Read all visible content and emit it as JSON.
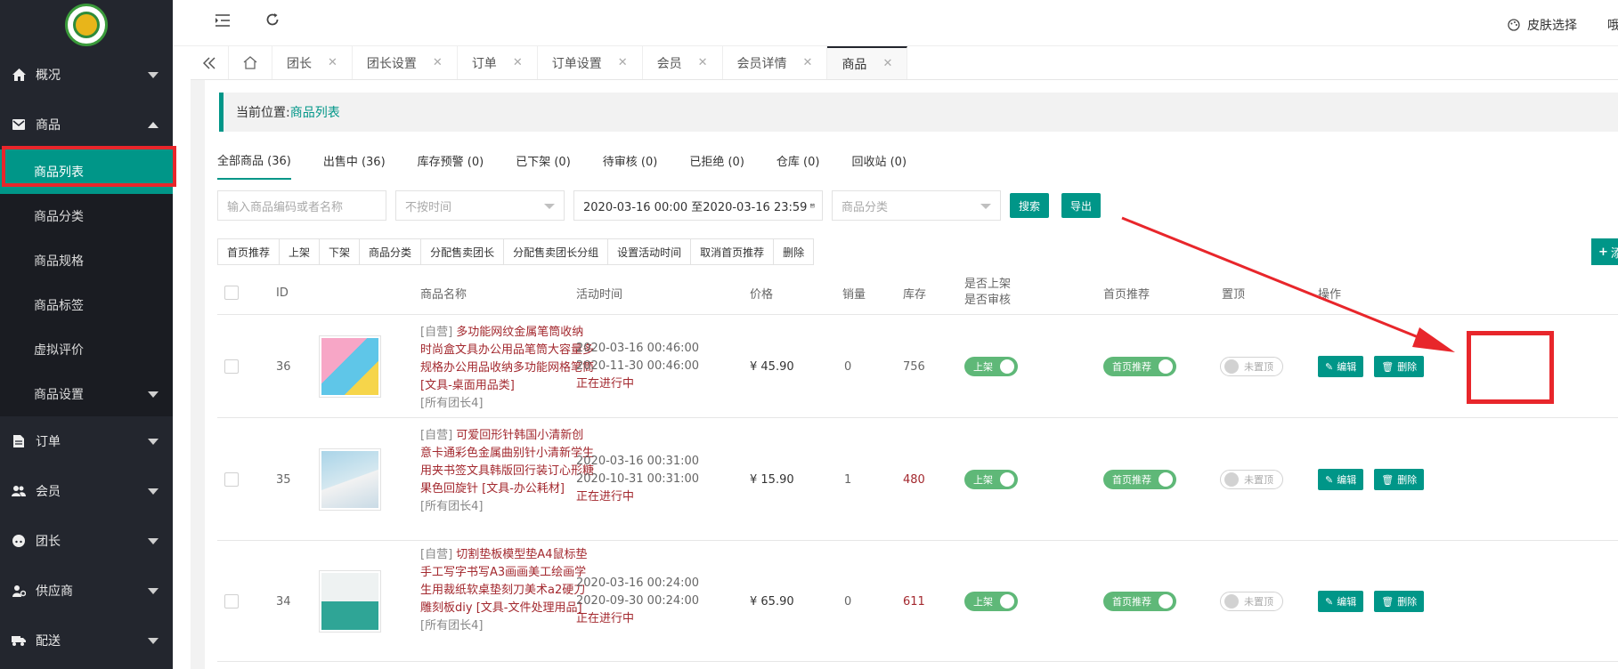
{
  "sidebar": {
    "items": [
      {
        "label": "概况",
        "icon": "home-icon",
        "expanded": false
      },
      {
        "label": "商品",
        "icon": "mail-icon",
        "expanded": true
      },
      {
        "label": "订单",
        "icon": "document-icon",
        "expanded": false
      },
      {
        "label": "会员",
        "icon": "users-icon",
        "expanded": false
      },
      {
        "label": "团长",
        "icon": "face-icon",
        "expanded": false
      },
      {
        "label": "供应商",
        "icon": "user-gear-icon",
        "expanded": false
      },
      {
        "label": "配送",
        "icon": "truck-icon",
        "expanded": false
      }
    ],
    "submenu": [
      {
        "label": "商品列表",
        "active": true
      },
      {
        "label": "商品分类"
      },
      {
        "label": "商品规格"
      },
      {
        "label": "商品标签"
      },
      {
        "label": "虚拟评价"
      },
      {
        "label": "商品设置",
        "has_children": true
      }
    ]
  },
  "topbar": {
    "skin_label": "皮肤选择",
    "cut_text": "哦"
  },
  "tabs": [
    {
      "label": "团长"
    },
    {
      "label": "团长设置"
    },
    {
      "label": "订单"
    },
    {
      "label": "订单设置"
    },
    {
      "label": "会员"
    },
    {
      "label": "会员详情"
    },
    {
      "label": "商品",
      "active": true
    }
  ],
  "breadcrumb": {
    "prefix": "当前位置:",
    "current": "商品列表"
  },
  "status_tabs": [
    {
      "label": "全部商品 (36)",
      "active": true
    },
    {
      "label": "出售中 (36)"
    },
    {
      "label": "库存预警 (0)"
    },
    {
      "label": "已下架 (0)"
    },
    {
      "label": "待审核 (0)"
    },
    {
      "label": "已拒绝 (0)"
    },
    {
      "label": "仓库 (0)"
    },
    {
      "label": "回收站 (0)"
    }
  ],
  "filters": {
    "keyword_placeholder": "输入商品编码或者名称",
    "time_select": "不按时间",
    "date_range": "2020-03-16 00:00 至2020-03-16 23:59",
    "category_select": "商品分类",
    "search_label": "搜索",
    "export_label": "导出"
  },
  "bulk_actions": [
    "首页推荐",
    "上架",
    "下架",
    "商品分类",
    "分配售卖团长",
    "分配售卖团长分组",
    "设置活动时间",
    "取消首页推荐",
    "删除"
  ],
  "add_label": "添",
  "table": {
    "headers": {
      "id": "ID",
      "name": "商品名称",
      "time": "活动时间",
      "price": "价格",
      "sales": "销量",
      "stock": "库存",
      "status_line1": "是否上架",
      "status_line2": "是否审核",
      "recommend": "首页推荐",
      "top": "置顶",
      "ops": "操作"
    },
    "rows": [
      {
        "id": "36",
        "tag": "[自营]",
        "name": "多功能网纹金属笔筒收纳时尚盒文具办公用品笔筒大容量多规格办公用品收纳多功能网格笔筒 [文具-桌面用品类]",
        "group": "[所有团长4]",
        "time_start": "2020-03-16 00:46:00",
        "time_end": "2020-11-30 00:46:00",
        "time_status": "正在进行中",
        "price": "¥ 45.90",
        "sales": "0",
        "stock": "756",
        "stock_warn": false,
        "on_shelf": "上架",
        "recommend": "首页推荐",
        "top": "未置顶",
        "edit": "编辑",
        "delete": "删除"
      },
      {
        "id": "35",
        "tag": "[自营]",
        "name": "可爱回形针韩国小清新创意卡通彩色金属曲别针小清新学生用夹书签文具韩版回行装订心形糖果色回旋针 [文具-办公耗材]",
        "group": "[所有团长4]",
        "time_start": "2020-03-16 00:31:00",
        "time_end": "2020-10-31 00:31:00",
        "time_status": "正在进行中",
        "price": "¥ 15.90",
        "sales": "1",
        "stock": "480",
        "stock_warn": true,
        "on_shelf": "上架",
        "recommend": "首页推荐",
        "top": "未置顶",
        "edit": "编辑",
        "delete": "删除"
      },
      {
        "id": "34",
        "tag": "[自营]",
        "name": "切割垫板模型垫A4鼠标垫手工写字书写A3画画美工绘画学生用裁纸软桌垫刻刀美术a2硬刀雕刻板diy [文具-文件处理用品]",
        "group": "[所有团长4]",
        "time_start": "2020-03-16 00:24:00",
        "time_end": "2020-09-30 00:24:00",
        "time_status": "正在进行中",
        "price": "¥ 65.90",
        "sales": "0",
        "stock": "611",
        "stock_warn": true,
        "on_shelf": "上架",
        "recommend": "首页推荐",
        "top": "未置顶",
        "edit": "编辑",
        "delete": "删除"
      }
    ]
  },
  "colors": {
    "accent": "#009688",
    "sidebar_bg": "#23262e",
    "highlight_red": "#e8262b",
    "toggle_green": "#5fb878",
    "product_red": "#a3282e"
  }
}
